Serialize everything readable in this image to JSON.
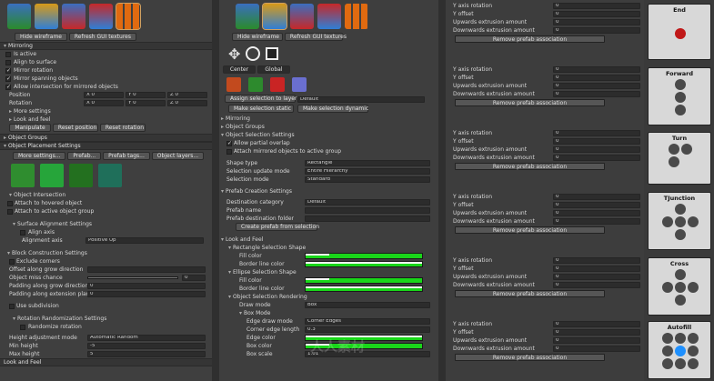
{
  "panel1": {
    "buttons": {
      "hide_wireframe": "Hide wireframe",
      "refresh_gui": "Refresh GUI textures"
    },
    "mirroring": "Mirroring",
    "is_active": "Is active",
    "align_to_surface": "Align to surface",
    "mirror_rotation": "Mirror rotation",
    "mirror_spanning": "Mirror spanning objects",
    "allow_intersection": "Allow intersection for mirrored objects",
    "position": "Position",
    "rotation": "Rotation",
    "pos_x": "X 0",
    "pos_y": "Y 0",
    "pos_z": "Z 0",
    "rot_x": "X 0",
    "rot_y": "Y 0",
    "rot_z": "Z 0",
    "more_settings": "More settings",
    "look_and_feel": "Look and feel",
    "manipulate": "Manipulate",
    "reset_position": "Reset position",
    "reset_rotation": "Reset rotation",
    "object_groups": "Object Groups",
    "placement_settings": "Object Placement Settings",
    "ps_buttons": [
      "More settings...",
      "Prefab...",
      "Prefab tags...",
      "Object layers..."
    ],
    "object_intersection": "Object Intersection",
    "attach_hovered": "Attach to hovered object",
    "attach_active_group": "Attach to active object group",
    "surface_alignment": "Surface Alignment Settings",
    "align_axis": "Align axis",
    "alignment_axis": "Alignment axis",
    "alignment_value": "Positive Up",
    "block_construction": "Block Construction Settings",
    "exclude_corners": "Exclude corners",
    "offset_grow": "Offset along grow direction",
    "object_miss": "Object miss chance",
    "object_miss_value": "0",
    "padding_grow": "Padding along grow direction",
    "padding_ext": "Padding along extension plan",
    "padding_grow_value": "0",
    "padding_ext_value": "0",
    "use_subdivision": "Use subdivision",
    "rotation_random": "Rotation Randomization Settings",
    "randomize_rotation": "Randomize rotation",
    "height_adj_mode": "Height adjustment mode",
    "height_adj_value": "Automatic Random",
    "min_height": "Min height",
    "min_height_value": "-5",
    "max_height": "Max height",
    "max_height_value": "5",
    "look_feel_bottom": "Look and Feel"
  },
  "panel2": {
    "buttons": {
      "hide_wireframe": "Hide wireframe",
      "refresh_gui": "Refresh GUI textures"
    },
    "pivot_a": "Center",
    "pivot_b": "Global",
    "assign_layer": "Assign selection to layer",
    "layer_value": "Default",
    "make_static": "Make selection static",
    "make_dynamic": "Make selection dynamic",
    "mirroring": "Mirroring",
    "object_groups": "Object Groups",
    "selection_settings": "Object Selection Settings",
    "allow_partial": "Allow partial overlap",
    "attach_mirrored": "Attach mirrored objects to active group",
    "shape_type": "Shape type",
    "shape_value": "Rectangle",
    "update_mode": "Selection update mode",
    "update_value": "Entire Hierarchy",
    "selection_mode": "Selection mode",
    "selection_mode_value": "Standard",
    "prefab_creation": "Prefab Creation Settings",
    "dest_category": "Destination category",
    "dest_value": "Default",
    "prefab_name": "Prefab name",
    "prefab_folder": "Prefab destination folder",
    "create_prefab": "Create prefab from selection",
    "look_feel": "Look and Feel",
    "rect_shape": "Rectangle Selection Shape",
    "fill_color": "Fill color",
    "border_color": "Border line color",
    "ellipse_shape": "Ellipse Selection Shape",
    "fill_color2": "Fill color",
    "border_color2": "Border line color",
    "rendering": "Object Selection Rendering",
    "draw_mode": "Draw mode",
    "draw_value": "Box",
    "box_mode": "Box Mode",
    "edge_draw_mode": "Edge draw mode",
    "edge_draw_value": "Corner Edges",
    "corner_edge_length": "Corner edge length",
    "corner_value": "0.3",
    "edge_color": "Edge color",
    "box_color": "Box color",
    "box_scale": "Box scale",
    "box_scale_value": "1.01"
  },
  "panel3": {
    "blocks": [
      {
        "rows": [
          [
            "Y axis rotation",
            "0"
          ],
          [
            "Y offset",
            "0"
          ],
          [
            "Upwards extrusion amount",
            "0"
          ],
          [
            "Downwards extrusion amount",
            "0"
          ]
        ],
        "btn": "Remove prefab association"
      },
      {
        "rows": [
          [
            "Y axis rotation",
            "0"
          ],
          [
            "Y offset",
            "0"
          ],
          [
            "Upwards extrusion amount",
            "0"
          ],
          [
            "Downwards extrusion amount",
            "0"
          ]
        ],
        "btn": "Remove prefab association"
      },
      {
        "rows": [
          [
            "Y axis rotation",
            "0"
          ],
          [
            "Y offset",
            "0"
          ],
          [
            "Upwards extrusion amount",
            "0"
          ],
          [
            "Downwards extrusion amount",
            "0"
          ]
        ],
        "btn": "Remove prefab association"
      },
      {
        "rows": [
          [
            "Y axis rotation",
            "0"
          ],
          [
            "Y offset",
            "0"
          ],
          [
            "Upwards extrusion amount",
            "0"
          ],
          [
            "Downwards extrusion amount",
            "0"
          ]
        ],
        "btn": "Remove prefab association"
      },
      {
        "rows": [
          [
            "Y axis rotation",
            "0"
          ],
          [
            "Y offset",
            "0"
          ],
          [
            "Upwards extrusion amount",
            "0"
          ],
          [
            "Downwards extrusion amount",
            "0"
          ]
        ],
        "btn": "Remove prefab association"
      },
      {
        "rows": [
          [
            "Y axis rotation",
            "0"
          ],
          [
            "Y offset",
            "0"
          ],
          [
            "Upwards extrusion amount",
            "0"
          ],
          [
            "Downwards extrusion amount",
            "0"
          ]
        ],
        "btn": "Remove prefab association"
      }
    ]
  },
  "panel4": {
    "cards": [
      "End",
      "Forward",
      "Turn",
      "TJunction",
      "Cross",
      "Autofill"
    ]
  },
  "watermark": "人人素材",
  "colors": {
    "accent": "#19d619",
    "end_dot": "#c01818",
    "autofill_dot": "#1e90ff"
  }
}
